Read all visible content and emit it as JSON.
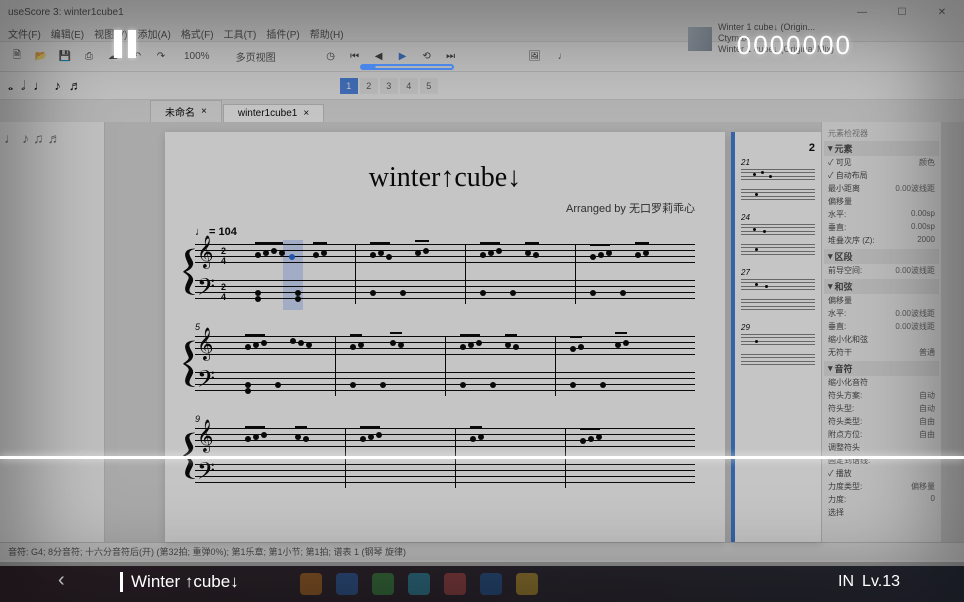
{
  "app_title": "useScore 3: winter1cube1",
  "window": {
    "minimize": "—",
    "maximize": "☐",
    "close": "✕"
  },
  "menus": [
    "文件(F)",
    "编辑(E)",
    "视图(V)",
    "添加(A)",
    "格式(F)",
    "工具(T)",
    "插件(P)",
    "帮助(H)"
  ],
  "toolbar": {
    "zoom": "100%",
    "view_mode": "多页视图",
    "tempo_btn": "♩"
  },
  "pages": [
    "1",
    "2",
    "3",
    "4",
    "5"
  ],
  "tabs": [
    {
      "label": "未命名",
      "close": "×",
      "active": false
    },
    {
      "label": "winter1cube1",
      "close": "×",
      "active": true
    }
  ],
  "media": {
    "title_line1": "Winter 1 cube↓ (Origin...",
    "title_line2": "Ctymax",
    "title_line3": "Winter 1 cube↓ (Original Mix)"
  },
  "score": {
    "title": "winter↑cube↓",
    "arranger_label": "Arranged by",
    "arranger": "无口罗莉乖心",
    "tempo": "♩ = 104",
    "time_sig_top": "2",
    "time_sig_bottom": "4",
    "page2_num": "2",
    "measure_labels": [
      "5",
      "9",
      "21",
      "24",
      "27",
      "29"
    ]
  },
  "properties": {
    "section_element": "元素",
    "visible_label": "可见",
    "color_label": "颜色",
    "autolayout_label": "自动布局",
    "min_dist": "最小距离",
    "min_dist_val": "0.00波线距",
    "offset_label": "偏移量",
    "horiz_label": "水平:",
    "horiz_val": "0.00sp",
    "vert_label": "垂直:",
    "vert_val": "0.00sp",
    "stacking_label": "堆叠次序 (Z):",
    "stacking_val": "2000",
    "section_segment": "区段",
    "leading_label": "前导空间:",
    "leading_val": "0.00波线距",
    "section_chord": "和弦",
    "offset2_label": "偏移量",
    "horiz2_label": "水平:",
    "horiz2_val": "0.00波线距",
    "vert2_label": "垂直:",
    "vert2_val": "0.00波线距",
    "small_label": "缩小化和弦",
    "stemless_label": "无符干",
    "stemless_val": "普通",
    "section_note": "音符",
    "small_note_label": "缩小化音符",
    "notehead_group_label": "符头方案:",
    "notehead_group_val": "自动",
    "notehead_type_label": "符头型:",
    "notehead_type_val": "自动",
    "mirror_label": "符头类型:",
    "mirror_val": "自由",
    "dot_label": "附点方位:",
    "dot_val": "自由",
    "tuning_label": "调整符头",
    "fix_label": "固定到谱线:",
    "play_label": "播放",
    "velocity_type_label": "力度类型:",
    "velocity_type_val": "偏移量",
    "velocity_label": "力度:",
    "velocity_val": "0",
    "select_label": "选择"
  },
  "statusbar": "音符: G4; 8分音符; 十六分音符后(开) (第32拍; 重弹0%); 第1乐章; 第1小节; 第1拍; 谱表 1 (钢琴 旋律)",
  "game": {
    "score": "0000000",
    "song_title": "Winter ↑cube↓",
    "difficulty_label": "IN",
    "level_label": "Lv.13"
  }
}
